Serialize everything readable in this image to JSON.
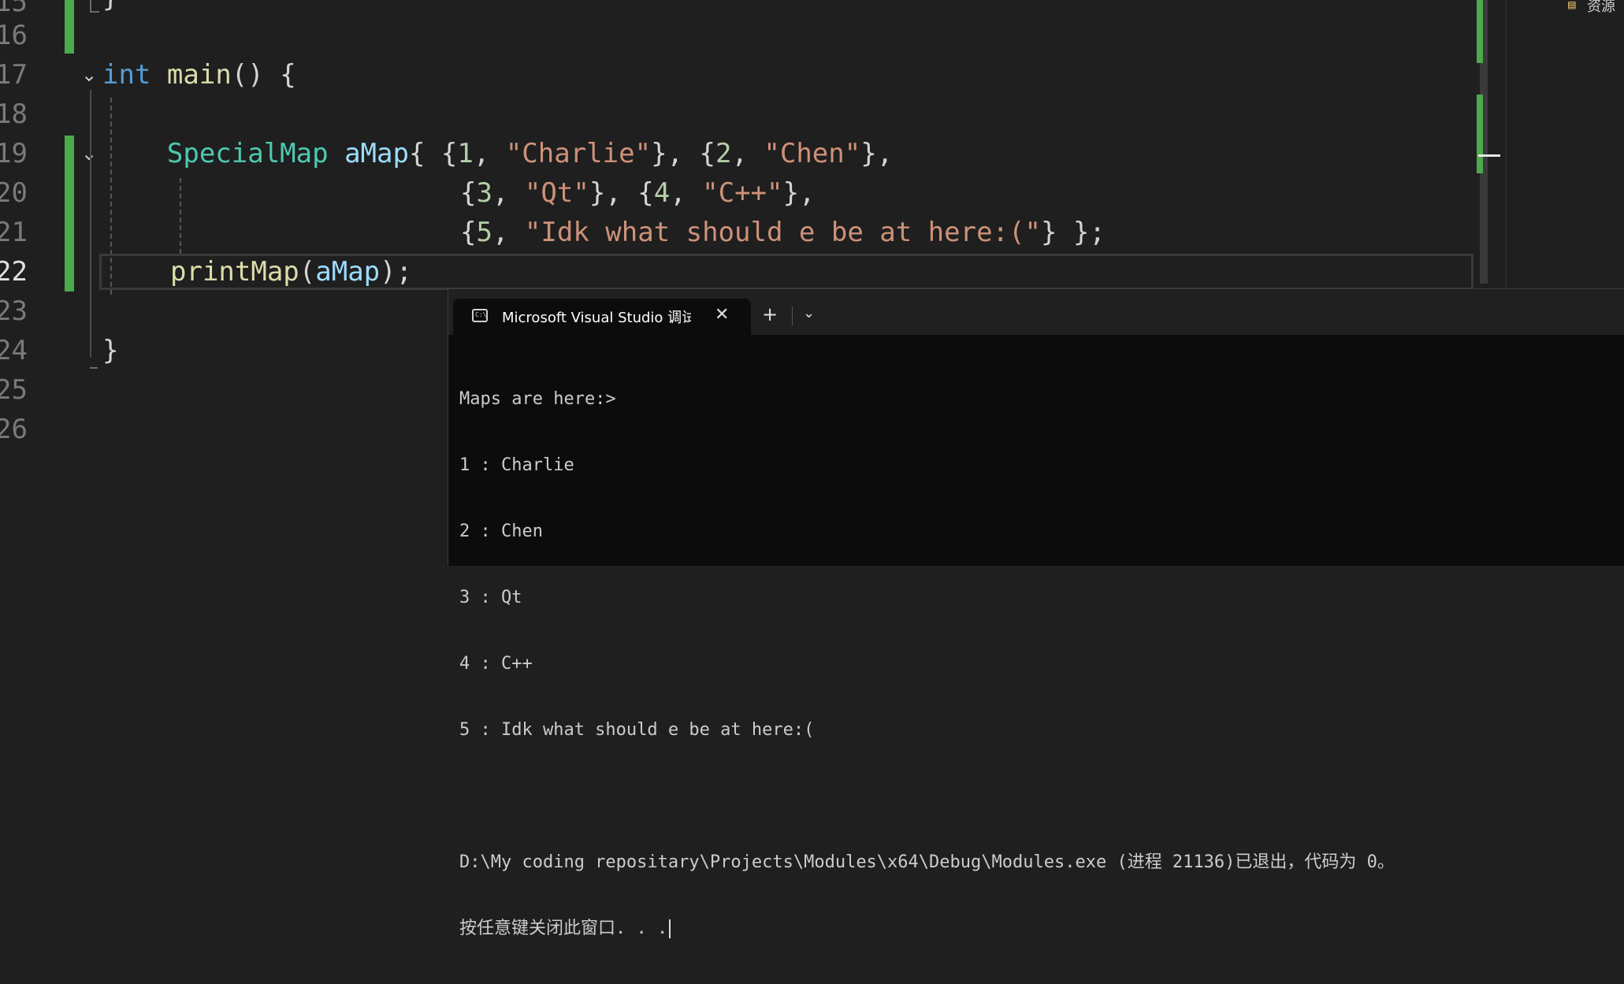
{
  "editor": {
    "line_numbers": [
      "15",
      "16",
      "17",
      "18",
      "19",
      "20",
      "21",
      "22",
      "23",
      "24",
      "25",
      "26"
    ],
    "lines": {
      "l15": {
        "brace": "}"
      },
      "l17": {
        "kw": "int",
        "fn": "main",
        "rest": "() {"
      },
      "l19": {
        "type": "SpecialMap",
        "var": "aMap",
        "p1": "{ {",
        "n1": "1",
        "c1": ", ",
        "s1": "\"Charlie\"",
        "p2": "}, {",
        "n2": "2",
        "c2": ", ",
        "s2": "\"Chen\"",
        "p3": "},"
      },
      "l20": {
        "p1": "{",
        "n1": "3",
        "c1": ", ",
        "s1": "\"Qt\"",
        "p2": "}, {",
        "n2": "4",
        "c2": ", ",
        "s2": "\"C++\"",
        "p3": "},"
      },
      "l21": {
        "p1": "{",
        "n1": "5",
        "c1": ", ",
        "s1": "\"Idk what should e be at here:(\"",
        "p2": "} };"
      },
      "l22": {
        "fn": "printMap",
        "open": "(",
        "var": "aMap",
        "close": ");"
      },
      "l24": {
        "brace": "}"
      }
    }
  },
  "right_pane": {
    "label": "资源",
    "icon": "solution-explorer-icon"
  },
  "terminal": {
    "tab_icon": "console-icon",
    "tab_icon_text": "C:\\",
    "tab_title": "Microsoft Visual Studio 调试控制台",
    "close_icon": "close-icon",
    "add_icon": "plus-icon",
    "dropdown_icon": "chevron-down-icon",
    "output": [
      "Maps are here:>",
      "1 : Charlie",
      "2 : Chen",
      "3 : Qt",
      "4 : C++",
      "5 : Idk what should e be at here:(",
      "",
      "D:\\My coding repositary\\Projects\\Modules\\x64\\Debug\\Modules.exe (进程 21136)已退出，代码为 0。",
      "按任意键关闭此窗口. . ."
    ]
  },
  "colors": {
    "keyword": "#569cd6",
    "function": "#dcdcaa",
    "type": "#4ec9b0",
    "variable": "#9cdcfe",
    "number": "#b5cea8",
    "string": "#ce9178",
    "change_bar": "#4caa4c"
  }
}
